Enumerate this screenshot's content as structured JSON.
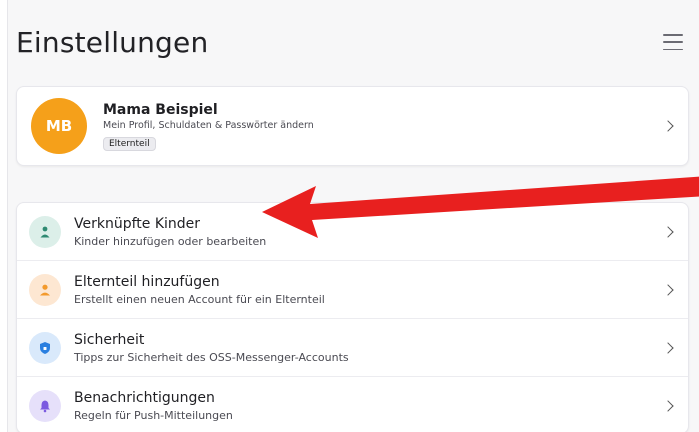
{
  "header": {
    "title": "Einstellungen",
    "menu_icon": "hamburger-menu-icon"
  },
  "profile": {
    "initials": "MB",
    "name": "Mama Beispiel",
    "subtitle": "Mein Profil, Schuldaten & Passwörter ändern",
    "role_badge": "Elternteil",
    "avatar_color": "#f5a01a"
  },
  "settings_items": [
    {
      "title": "Verknüpfte Kinder",
      "subtitle": "Kinder hinzufügen oder bearbeiten",
      "icon": "child-icon",
      "icon_bg": "#dcefe9",
      "icon_color": "#2f8a72"
    },
    {
      "title": "Elternteil hinzufügen",
      "subtitle": "Erstellt einen neuen Account für ein Elternteil",
      "icon": "person-icon",
      "icon_bg": "#fde7d2",
      "icon_color": "#f39a2c"
    },
    {
      "title": "Sicherheit",
      "subtitle": "Tipps zur Sicherheit des OSS-Messenger-Accounts",
      "icon": "shield-icon",
      "icon_bg": "#d9e9fb",
      "icon_color": "#2a7fe0"
    },
    {
      "title": "Benachrichtigungen",
      "subtitle": "Regeln für Push-Mitteilungen",
      "icon": "bell-icon",
      "icon_bg": "#e6e0fa",
      "icon_color": "#7b5ae0"
    }
  ],
  "annotation": {
    "arrow_color": "#e8201f"
  }
}
